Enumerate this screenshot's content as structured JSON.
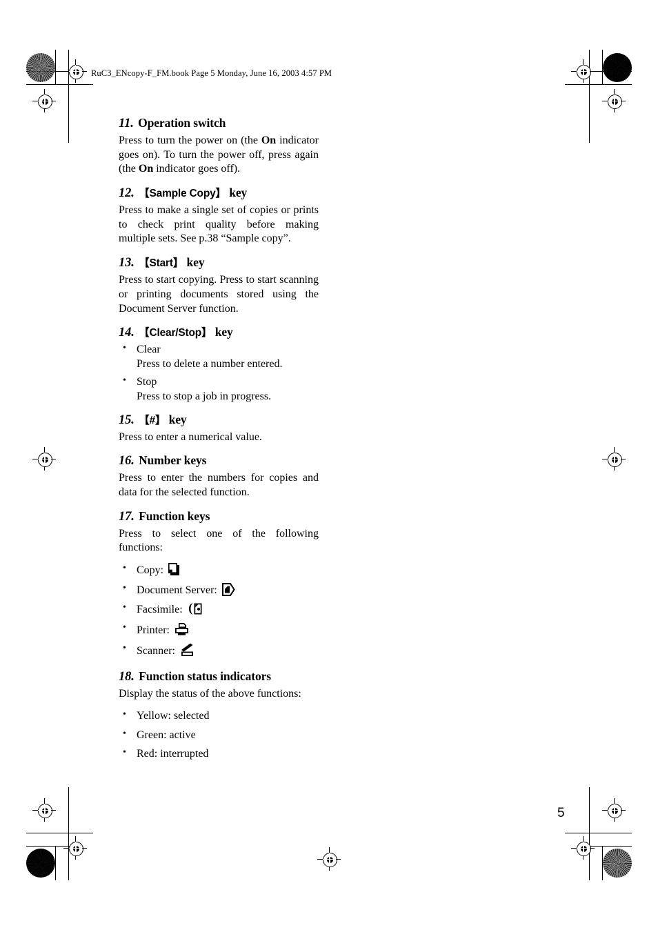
{
  "page": {
    "file_header": "RuC3_ENcopy-F_FM.book   Page 5   Monday, June 16, 2003   4:57 PM",
    "page_number": "5"
  },
  "sections": [
    {
      "number": "11.",
      "title": "Operation switch",
      "title_is_key": false,
      "paragraphs": [
        "Press to turn the power on (the On indicator goes on). To turn the power off, press again (the On indicator goes off)."
      ],
      "paragraph_parts": [
        {
          "text": "Press to turn the power on (the "
        },
        {
          "text": "On",
          "bold": true
        },
        {
          "text": " indicator goes on). To turn the power off, press again (the "
        },
        {
          "text": "On",
          "bold": true
        },
        {
          "text": " indicator goes off)."
        }
      ]
    },
    {
      "number": "12.",
      "key_label": "Sample Copy",
      "key_suffix": "key",
      "title_is_key": true,
      "paragraphs": [
        "Press to make a single set of copies or prints to check print quality before making multiple sets. See p.38 “Sample copy”."
      ]
    },
    {
      "number": "13.",
      "key_label": "Start",
      "key_suffix": "key",
      "title_is_key": true,
      "paragraphs": [
        "Press to start copying. Press to start scanning or printing documents stored using the Document Server function."
      ]
    },
    {
      "number": "14.",
      "key_label": "Clear/Stop",
      "key_suffix": "key",
      "title_is_key": true,
      "bullets": [
        {
          "label": "Clear",
          "detail": "Press to delete a number entered."
        },
        {
          "label": "Stop",
          "detail": "Press to stop a job in progress."
        }
      ]
    },
    {
      "number": "15.",
      "key_label": "#",
      "key_suffix": "key",
      "title_is_key": true,
      "paragraphs": [
        "Press to enter a numerical value."
      ]
    },
    {
      "number": "16.",
      "title": "Number keys",
      "title_is_key": false,
      "paragraphs": [
        "Press to enter the numbers for copies and data for the selected function."
      ]
    },
    {
      "number": "17.",
      "title": "Function keys",
      "title_is_key": false,
      "paragraphs": [
        "Press to select one of the following functions:"
      ],
      "function_list": [
        {
          "label": "Copy:",
          "icon": "copy-function-icon"
        },
        {
          "label": "Document Server:",
          "icon": "document-server-function-icon"
        },
        {
          "label": "Facsimile:",
          "icon": "facsimile-function-icon"
        },
        {
          "label": "Printer:",
          "icon": "printer-function-icon"
        },
        {
          "label": "Scanner:",
          "icon": "scanner-function-icon"
        }
      ]
    },
    {
      "number": "18.",
      "title": "Function status indicators",
      "title_is_key": false,
      "paragraphs": [
        "Display the status of the above functions:"
      ],
      "status_list": [
        "Yellow: selected",
        "Green: active",
        "Red: interrupted"
      ]
    }
  ],
  "labels": {
    "bracket_open": "【",
    "bracket_close": "】"
  }
}
